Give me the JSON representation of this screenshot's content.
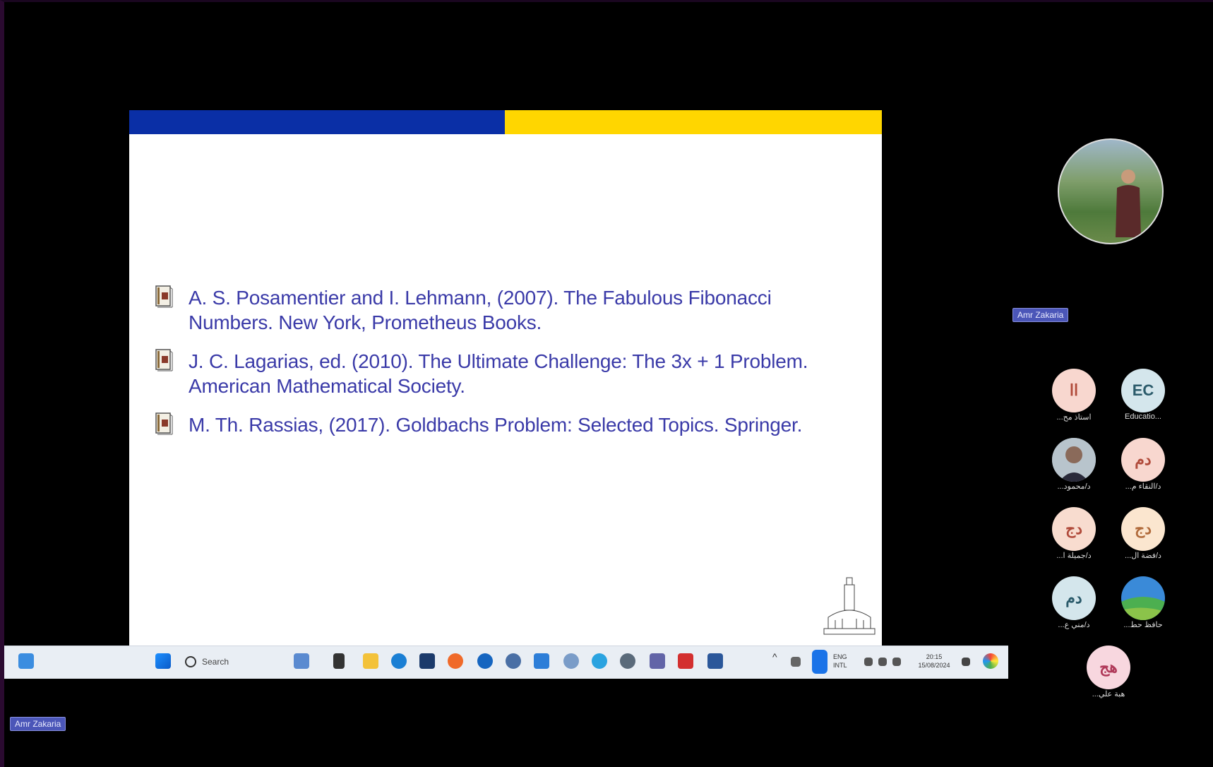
{
  "slide": {
    "references": [
      {
        "text": "A. S. Posamentier and I. Lehmann, (2007). The Fabulous Fibonacci Numbers. New York, Prometheus Books."
      },
      {
        "text": "J. C. Lagarias, ed. (2010). The Ultimate Challenge: The 3x + 1 Problem. American Mathematical Society."
      },
      {
        "text": "M. Th. Rassias, (2017). Goldbachs Problem: Selected Topics. Springer."
      }
    ],
    "colors": {
      "band_left": "#0a2fa6",
      "band_right": "#ffd600",
      "ref_text": "#3a3aa8"
    }
  },
  "taskbar": {
    "search_placeholder": "Search",
    "tray_lang": "ENG\nINTL",
    "clock_time": "20:15",
    "clock_date": "15/08/2024"
  },
  "meeting": {
    "presenter_name": "Amr Zakaria",
    "self_name": "Amr Zakaria",
    "participants": [
      {
        "initials": "اا",
        "name": "...استاذ مح"
      },
      {
        "initials": "EC",
        "name": "Educatio..."
      },
      {
        "initials": "",
        "name": "...د/محمود"
      },
      {
        "initials": "دم",
        "name": "...د/النقاء م"
      },
      {
        "initials": "دج",
        "name": "...د/جميلة ا"
      },
      {
        "initials": "دج",
        "name": "...د/فضة ال"
      },
      {
        "initials": "دم",
        "name": "...د/مني ع"
      },
      {
        "initials": "",
        "name": "...حافظ حط"
      },
      {
        "initials": "هج",
        "name": "...هبة علي"
      }
    ]
  }
}
